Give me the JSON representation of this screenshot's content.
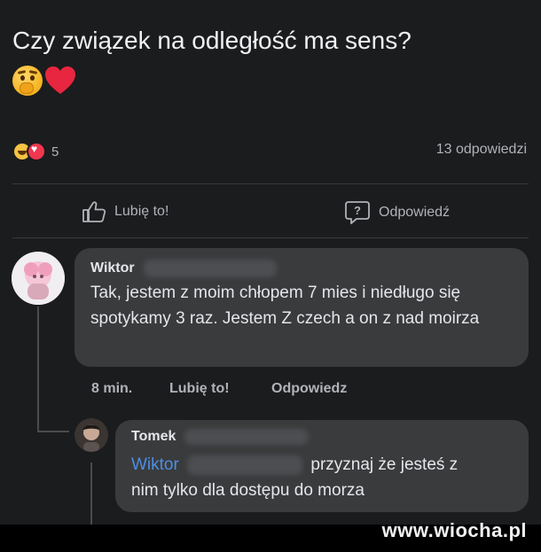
{
  "post": {
    "title": "Czy związek na odległość ma sens?",
    "reaction_count": "5",
    "replies_count": "13 odpowiedzi"
  },
  "actions": {
    "like_label": "Lubię to!",
    "reply_label": "Odpowiedź"
  },
  "comment": {
    "author": "Wiktor",
    "text": "Tak, jestem z moim chłopem 7 mies i niedługo się spotykamy 3 raz. Jestem Z czech a on z nad moirza",
    "time": "8 min.",
    "like_label": "Lubię to!",
    "reply_label": "Odpowiedz"
  },
  "reply": {
    "author": "Tomek",
    "mention": "Wiktor",
    "text_line1": "przyznaj że jesteś z",
    "text_line2": "nim tylko dla dostępu do morza"
  },
  "watermark": "www.wiocha.pl",
  "colors": {
    "background": "#1b1c1e",
    "bubble": "#3a3b3c",
    "mention": "#4d8fe6",
    "muted": "#b0b3b8"
  },
  "icons": [
    "thinking-face-icon",
    "heart-icon",
    "haha-reaction-icon",
    "love-reaction-icon",
    "thumbs-up-icon",
    "question-bubble-icon"
  ]
}
